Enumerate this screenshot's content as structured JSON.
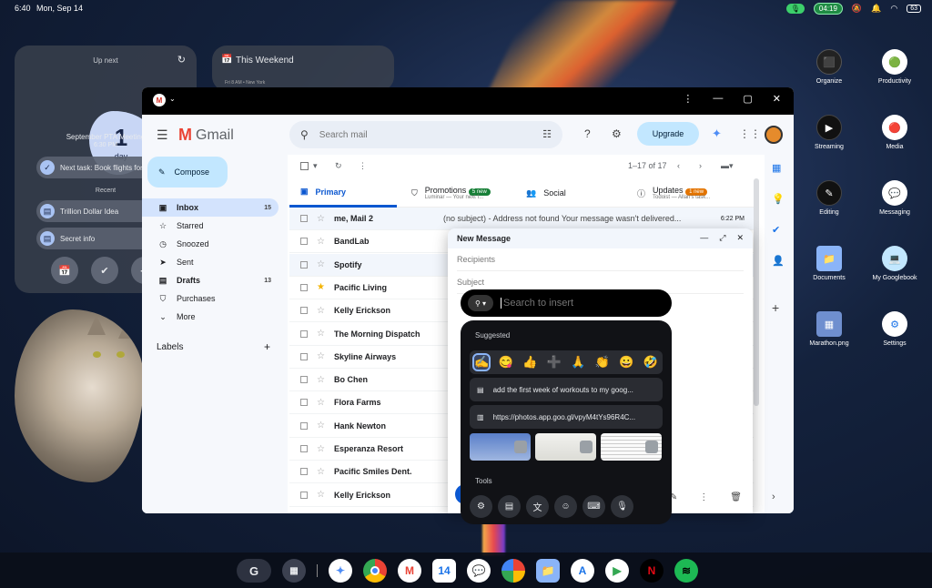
{
  "status": {
    "time": "6:40",
    "date": "Mon, Sep 14",
    "pill": "04:19",
    "battery": "63"
  },
  "upnext": {
    "title": "Up next",
    "day_number": "1",
    "day_label": "day",
    "event": "September PTA Meeting",
    "event_time": "6:30 PM",
    "task": "Next task: Book flights for NY",
    "recent_label": "Recent",
    "recent": [
      "Trillion Dollar Idea",
      "Secret info"
    ]
  },
  "weekend": {
    "title": "This Weekend",
    "sub": "Fri 8 AM • New York"
  },
  "apps": [
    {
      "label": "Organize"
    },
    {
      "label": "Productivity"
    },
    {
      "label": "Streaming"
    },
    {
      "label": "Media"
    },
    {
      "label": "Editing"
    },
    {
      "label": "Messaging"
    },
    {
      "label": "Documents"
    },
    {
      "label": "My Googlebook"
    },
    {
      "label": "Marathon.png"
    },
    {
      "label": "Settings"
    }
  ],
  "gmail": {
    "logo": "Gmail",
    "search_placeholder": "Search mail",
    "upgrade": "Upgrade",
    "compose": "Compose",
    "nav": [
      {
        "label": "Inbox",
        "count": "15"
      },
      {
        "label": "Starred",
        "count": ""
      },
      {
        "label": "Snoozed",
        "count": ""
      },
      {
        "label": "Sent",
        "count": ""
      },
      {
        "label": "Drafts",
        "count": "13"
      },
      {
        "label": "Purchases",
        "count": ""
      },
      {
        "label": "More",
        "count": ""
      }
    ],
    "labels": "Labels",
    "pagination": "1–17 of 17",
    "tabs": {
      "primary": "Primary",
      "promotions": "Promotions",
      "promotions_badge": "5 new",
      "promotions_sub": "Luminar — Your next f...",
      "social": "Social",
      "updates": "Updates",
      "updates_badge": "1 new",
      "updates_sub": "Todoist — Allan's task..."
    },
    "emails": [
      {
        "sender": "me, Mail 2",
        "snippet": "(no subject) - Address not found Your message wasn't delivered...",
        "time": "6:22 PM"
      },
      {
        "sender": "BandLab",
        "snippet": "",
        "time": ""
      },
      {
        "sender": "Spotify",
        "snippet": "",
        "time": ""
      },
      {
        "sender": "Pacific Living",
        "snippet": "",
        "time": ""
      },
      {
        "sender": "Kelly Erickson",
        "snippet": "",
        "time": ""
      },
      {
        "sender": "The Morning Dispatch",
        "snippet": "",
        "time": ""
      },
      {
        "sender": "Skyline Airways",
        "snippet": "",
        "time": ""
      },
      {
        "sender": "Bo Chen",
        "snippet": "",
        "time": ""
      },
      {
        "sender": "Flora Farms",
        "snippet": "",
        "time": ""
      },
      {
        "sender": "Hank Newton",
        "snippet": "",
        "time": ""
      },
      {
        "sender": "Esperanza Resort",
        "snippet": "",
        "time": ""
      },
      {
        "sender": "Pacific Smiles Dent.",
        "snippet": "",
        "time": ""
      },
      {
        "sender": "Kelly Erickson",
        "snippet": "",
        "time": ""
      }
    ]
  },
  "newmsg": {
    "title": "New Message",
    "recipients": "Recipients",
    "subject": "Subject"
  },
  "quickinsert": {
    "placeholder": "Search to insert",
    "suggested": "Suggested",
    "emojis": [
      "✍",
      "😋",
      "👍",
      "➕",
      "🙏",
      "👏",
      "😀",
      "🤣"
    ],
    "item1": "add the first week of workouts to my goog...",
    "item2": "https://photos.app.goo.gl/vpyM4tYs96R4C...",
    "tools": "Tools"
  },
  "colors": {
    "accent": "#0b57d0",
    "compose": "#c2e7ff",
    "badge_green": "#188038",
    "badge_orange": "#e37400"
  }
}
